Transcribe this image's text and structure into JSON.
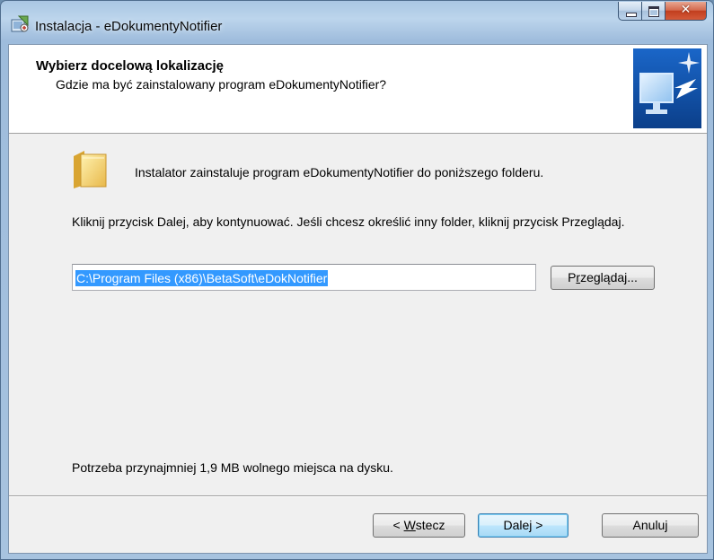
{
  "window": {
    "title": "Instalacja - eDokumentyNotifier",
    "icon": "installer-icon",
    "controls": {
      "minimize": "minimize-icon",
      "maximize": "maximize-icon",
      "close": "close-icon"
    }
  },
  "header": {
    "title": "Wybierz docelową lokalizację",
    "subtitle": "Gdzie ma być zainstalowany program eDokumentyNotifier?",
    "image": "computer-arrow-icon"
  },
  "body": {
    "folder_icon": "folder-icon",
    "intro": "Instalator zainstaluje program eDokumentyNotifier do poniższego folderu.",
    "instruction": "Kliknij przycisk Dalej, aby kontynuować. Jeśli chcesz określić inny folder, kliknij przycisk Przeglądaj.",
    "path_value": "C:\\Program Files (x86)\\BetaSoft\\eDokNotifier",
    "browse": {
      "pre": "P",
      "accel": "r",
      "post": "zeglądaj..."
    },
    "space_required": "Potrzeba przynajmniej 1,9 MB wolnego miejsca na dysku."
  },
  "footer": {
    "back": {
      "pre": "< ",
      "accel": "W",
      "post": "stecz"
    },
    "next": "Dalej >",
    "cancel": "Anuluj"
  },
  "colors": {
    "accent": "#3399ff",
    "close_button": "#c13e1e",
    "default_button_border": "#3c7fb1"
  }
}
